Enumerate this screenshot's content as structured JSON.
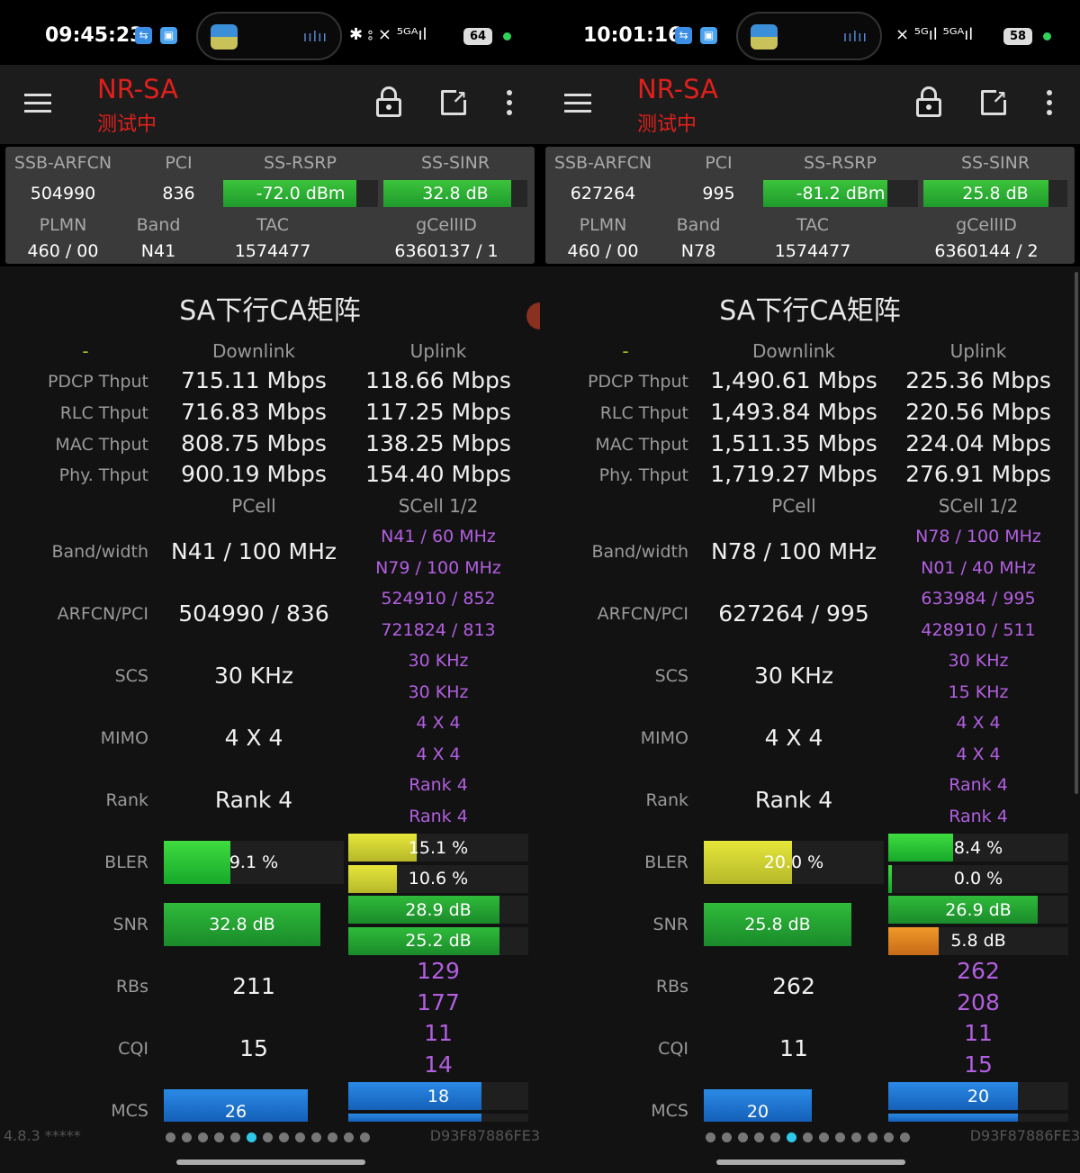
{
  "screens": [
    {
      "status": {
        "time": "09:45:23",
        "battery": "64",
        "icons": "✱ ⦂ ⨯ ⁵ᴳᴬıl"
      },
      "app": {
        "title": "NR-SA",
        "subtitle": "测试中"
      },
      "card": {
        "labels": {
          "ssb_arfcn": "SSB-ARFCN",
          "pci": "PCI",
          "rsrp": "SS-RSRP",
          "sinr": "SS-SINR",
          "plmn": "PLMN",
          "band": "Band",
          "tac": "TAC",
          "gcellid": "gCellID"
        },
        "ssb_arfcn": "504990",
        "pci": "836",
        "rsrp": "-72.0 dBm",
        "rsrp_level": 0.86,
        "sinr": "32.8 dB",
        "sinr_level": 0.89,
        "plmn": "460 / 00",
        "band": "N41",
        "tac": "1574477",
        "gcellid": "6360137 / 1"
      },
      "matrix": {
        "title": "SA下行CA矩阵",
        "corner": "-",
        "downlink": "Downlink",
        "uplink": "Uplink",
        "rows": {
          "pdcp": "PDCP Thput",
          "rlc": "RLC Thput",
          "mac": "MAC Thput",
          "phy": "Phy. Thput",
          "band": "Band/width",
          "arfcn": "ARFCN/PCI",
          "scs": "SCS",
          "mimo": "MIMO",
          "rank": "Rank",
          "bler": "BLER",
          "snr": "SNR",
          "rbs": "RBs",
          "cqi": "CQI",
          "mcs": "MCS"
        },
        "dl": {
          "pdcp": "715.11 Mbps",
          "rlc": "716.83 Mbps",
          "mac": "808.75 Mbps",
          "phy": "900.19 Mbps"
        },
        "ul": {
          "pdcp": "118.66 Mbps",
          "rlc": "117.25 Mbps",
          "mac": "138.25 Mbps",
          "phy": "154.40 Mbps"
        },
        "pcell_label": "PCell",
        "scell_label": "SCell 1/2",
        "pcell": {
          "band": "N41 / 100 MHz",
          "arfcn": "504990 / 836",
          "scs": "30 KHz",
          "mimo": "4 X 4",
          "rank": "Rank 4",
          "bler": "9.1 %",
          "bler_level": 0.37,
          "snr": "32.8 dB",
          "snr_level": 0.87,
          "rbs": "211",
          "cqi": "15",
          "mcs": "26",
          "mcs_level": 0.8
        },
        "scell": {
          "band": [
            "N41 / 60 MHz",
            "N79 / 100 MHz"
          ],
          "arfcn": [
            "524910 / 852",
            "721824 / 813"
          ],
          "scs": [
            "30 KHz",
            "30 KHz"
          ],
          "mimo": [
            "4 X 4",
            "4 X 4"
          ],
          "rank": [
            "Rank 4",
            "Rank 4"
          ],
          "bler": [
            "15.1 %",
            "10.6 %"
          ],
          "bler_level": [
            0.38,
            0.27
          ],
          "bler_color": [
            "yellow",
            "yellow"
          ],
          "snr": [
            "28.9 dB",
            "25.2 dB"
          ],
          "snr_level": [
            0.84,
            0.84
          ],
          "rbs": [
            "129",
            "177"
          ],
          "cqi": [
            "11",
            "14"
          ],
          "mcs": [
            "18"
          ],
          "mcs_level": [
            0.74,
            0.74
          ]
        }
      },
      "footer": {
        "version": "4.8.3 *****",
        "device": "D93F87886FE3",
        "active_page": 5
      }
    },
    {
      "status": {
        "time": "10:01:16",
        "battery": "58",
        "icons": "⨯ ⁵ᴳıl ⁵ᴳᴬıl"
      },
      "app": {
        "title": "NR-SA",
        "subtitle": "测试中"
      },
      "card": {
        "labels": {
          "ssb_arfcn": "SSB-ARFCN",
          "pci": "PCI",
          "rsrp": "SS-RSRP",
          "sinr": "SS-SINR",
          "plmn": "PLMN",
          "band": "Band",
          "tac": "TAC",
          "gcellid": "gCellID"
        },
        "ssb_arfcn": "627264",
        "pci": "995",
        "rsrp": "-81.2 dBm",
        "rsrp_level": 0.8,
        "sinr": "25.8 dB",
        "sinr_level": 0.87,
        "plmn": "460 / 00",
        "band": "N78",
        "tac": "1574477",
        "gcellid": "6360144 / 2"
      },
      "matrix": {
        "title": "SA下行CA矩阵",
        "corner": "-",
        "downlink": "Downlink",
        "uplink": "Uplink",
        "rows": {
          "pdcp": "PDCP Thput",
          "rlc": "RLC Thput",
          "mac": "MAC Thput",
          "phy": "Phy. Thput",
          "band": "Band/width",
          "arfcn": "ARFCN/PCI",
          "scs": "SCS",
          "mimo": "MIMO",
          "rank": "Rank",
          "bler": "BLER",
          "snr": "SNR",
          "rbs": "RBs",
          "cqi": "CQI",
          "mcs": "MCS"
        },
        "dl": {
          "pdcp": "1,490.61 Mbps",
          "rlc": "1,493.84 Mbps",
          "mac": "1,511.35 Mbps",
          "phy": "1,719.27 Mbps"
        },
        "ul": {
          "pdcp": "225.36 Mbps",
          "rlc": "220.56 Mbps",
          "mac": "224.04 Mbps",
          "phy": "276.91 Mbps"
        },
        "pcell_label": "PCell",
        "scell_label": "SCell 1/2",
        "pcell": {
          "band": "N78 / 100 MHz",
          "arfcn": "627264 / 995",
          "scs": "30 KHz",
          "mimo": "4 X 4",
          "rank": "Rank 4",
          "bler": "20.0 %",
          "bler_level": 0.49,
          "snr": "25.8 dB",
          "snr_level": 0.82,
          "rbs": "262",
          "cqi": "11",
          "mcs": "20",
          "mcs_level": 0.6
        },
        "scell": {
          "band": [
            "N78 / 100 MHz",
            "N01 / 40 MHz"
          ],
          "arfcn": [
            "633984 / 995",
            "428910 / 511"
          ],
          "scs": [
            "30 KHz",
            "15 KHz"
          ],
          "mimo": [
            "4 X 4",
            "4 X 4"
          ],
          "rank": [
            "Rank 4",
            "Rank 4"
          ],
          "bler": [
            "8.4 %",
            "0.0 %"
          ],
          "bler_level": [
            0.36,
            0.02
          ],
          "bler_color": [
            "green",
            "green"
          ],
          "snr": [
            "26.9 dB",
            "5.8 dB"
          ],
          "snr_level": [
            0.83,
            0.28
          ],
          "snr_color": [
            "green",
            "orange"
          ],
          "rbs": [
            "262",
            "208"
          ],
          "cqi": [
            "11",
            "15"
          ],
          "mcs": [
            "20"
          ],
          "mcs_level": [
            0.72,
            0.72
          ]
        }
      },
      "footer": {
        "version": "",
        "device": "D93F87886FE3",
        "active_page": 5
      }
    }
  ]
}
